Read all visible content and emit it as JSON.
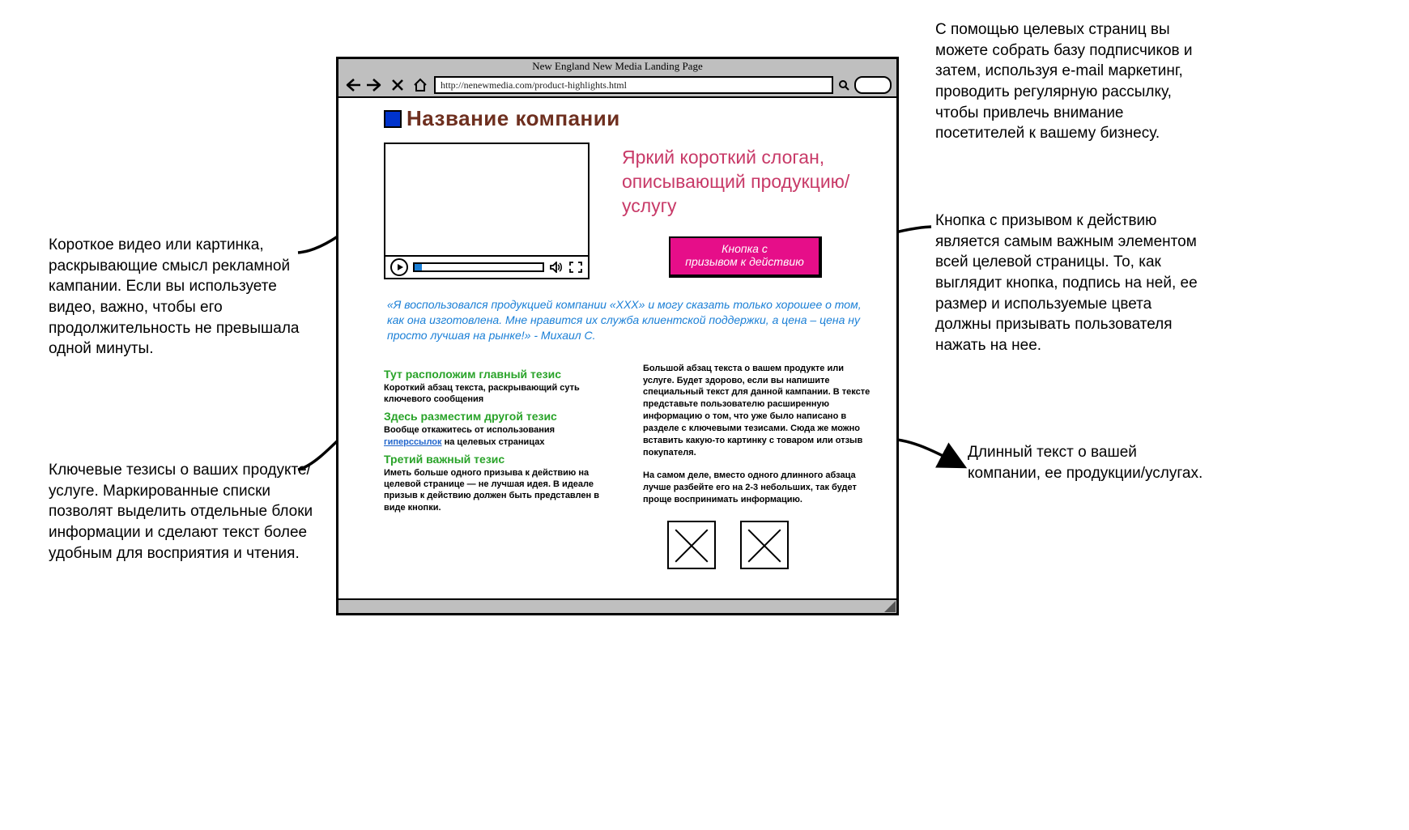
{
  "browser": {
    "title": "New England New Media Landing Page",
    "url": "http://nenewmedia.com/product-highlights.html"
  },
  "page": {
    "company_name": "Название компании",
    "slogan": "Яркий короткий слоган, описывающий продукцию/услугу",
    "cta_label": "Кнопка с\nпризывом к действию",
    "quote": "«Я воспользовался продукцией компании «XXX» и могу сказать только хорошее о том, как она изготовлена. Мне нравится их служба клиентской поддержки, а цена – цена ну просто лучшая на рынке!» - Михаил С.",
    "tezis1_h": "Тут расположим главный тезис",
    "tezis1_p": "Короткий абзац текста, раскрывающий суть ключевого сообщения",
    "tezis2_h": "Здесь разместим другой тезис",
    "tezis2_p_before": "Вообще откажитесь от использования ",
    "tezis2_link": "гиперссылок",
    "tezis2_p_after": " на целевых страницах",
    "tezis3_h": "Третий важный тезис",
    "tezis3_p": "Иметь больше одного призыва к действию на целевой странице — не лучшая идея. В идеале призыв к действию должен быть представлен в виде кнопки.",
    "right_p1": "Большой абзац текста о вашем продукте или услуге. Будет здорово, если вы напишите специальный текст для данной кампании. В тексте представьте пользователю расширенную информацию о том, что уже было написано в разделе с ключевыми тезисами. Сюда же можно вставить какую-то картинку с товаром или отзыв покупателя.",
    "right_p2": "На самом деле, вместо одного длинного абзаца лучше разбейте его на 2-3 небольших, так будет проще воспринимать информацию."
  },
  "annotations": {
    "top_right": "С помощью целевых страниц вы можете собрать базу подписчиков и затем, используя e-mail маркетинг, проводить регулярную рассылку, чтобы привлечь внимание посетителей к вашему бизнесу.",
    "video": "Короткое видео или картинка, раскрывающие смысл рекламной кампании. Если вы используете видео, важно, чтобы его продолжительность не превышала одной минуты.",
    "cta": "Кнопка с призывом к действию является самым важным элементом всей целевой страницы. То, как выглядит кнопка, подпись на ней, ее размер и используемые цвета должны призывать пользователя нажать на нее.",
    "tezisy": "Ключевые тезисы о ваших продукте/услуге. Маркированные списки позволят выделить отдельные блоки информации и сделают текст более удобным для восприятия и чтения.",
    "longtext": "Длинный текст о вашей компании, ее продукции/услугах."
  }
}
